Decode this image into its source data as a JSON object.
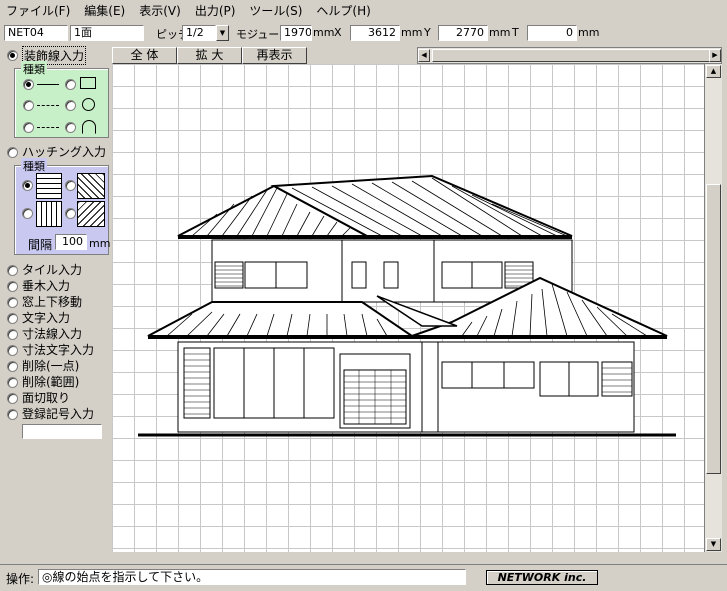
{
  "menu": [
    "ファイル(F)",
    "編集(E)",
    "表示(V)",
    "出力(P)",
    "ツール(S)",
    "ヘルプ(H)"
  ],
  "toolbar": {
    "project": "NET04",
    "floor": "1面",
    "pitch_label": "ピッチ",
    "pitch_value": "1/2",
    "module_label": "モジュール",
    "module_value": "1970",
    "unit": "mm",
    "x_label": "X",
    "x_value": "3612",
    "y_label": "Y",
    "y_value": "2770",
    "t_label": "T",
    "t_value": "0"
  },
  "view_buttons": [
    "全 体",
    "拡 大",
    "再表示"
  ],
  "left_panel": {
    "decor_line": "装飾線入力",
    "kind_label": "種類",
    "hatching": "ハッチング入力",
    "hatch_kind_label": "種類",
    "spacing_label": "間隔",
    "spacing_value": "100",
    "spacing_unit": "mm",
    "modes": [
      "タイル入力",
      "垂木入力",
      "窓上下移動",
      "文字入力",
      "寸法線入力",
      "寸法文字入力",
      "削除(一点)",
      "削除(範囲)",
      "面切取り",
      "登録記号入力"
    ],
    "modes_input_value": ""
  },
  "status": {
    "label": "操作:",
    "message": "◎線の始点を指示して下さい。",
    "brand": "NETWORK inc."
  },
  "colors": {
    "line_group_bg": "#c8f0c8",
    "hatch_group_bg": "#c8c8f0",
    "canvas_bg": "#ffffff",
    "grid": "#c8c8c8"
  }
}
